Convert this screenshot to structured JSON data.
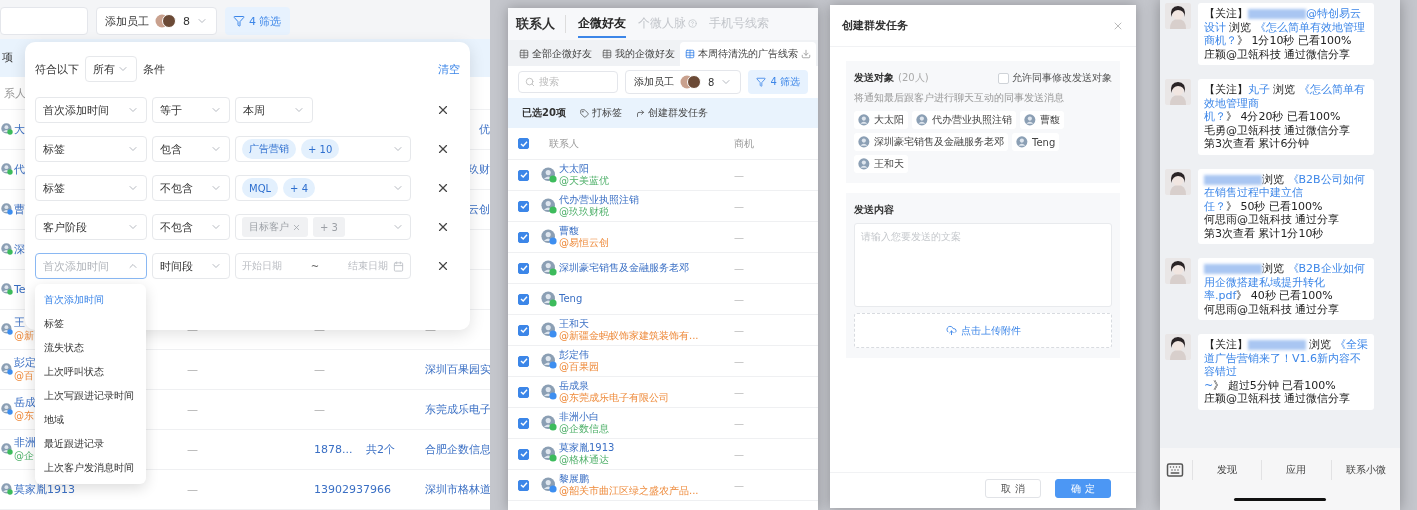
{
  "contacts_list": {
    "toolbar": {
      "staff_button": "添加员工",
      "staff_count": "8",
      "filter_button": "4 筛选"
    },
    "selection_bar_fragment": "项",
    "header_fragment": "系人",
    "rows": [
      {
        "name": "大",
        "kind": "wechat",
        "right": "优"
      },
      {
        "name": "代",
        "kind": "wechat",
        "right": "玖财"
      },
      {
        "name": "曹",
        "kind": "wecom",
        "right": "云创"
      },
      {
        "name": "深",
        "kind": "wechat"
      },
      {
        "name": "Te",
        "kind": "wechat"
      },
      {
        "name": "王",
        "sub": "@新",
        "kind": "wecom",
        "col_2": "—",
        "col_3": "—",
        "col_5": "—"
      },
      {
        "name": "彭定",
        "sub": "@百",
        "kind": "wecom",
        "col_2": "—",
        "col_3": "—",
        "col_5": "深圳百果园实"
      },
      {
        "name": "岳成",
        "sub": "@东",
        "kind": "wecom",
        "col_2": "—",
        "col_3": "—",
        "col_5": "东莞成乐电子"
      },
      {
        "name": "非洲",
        "sub": "@企",
        "kind": "wechat",
        "col_2": "—",
        "col_3": "1878...",
        "col_4": "共2个",
        "col_5": "合肥企数信息"
      },
      {
        "name": "莫家胤1913",
        "kind": "wechat",
        "col_2": "—",
        "col_3": "13902937966",
        "col_5": "深圳市格林道"
      }
    ],
    "filter_popover": {
      "match_prefix": "符合以下",
      "match_mode": "所有",
      "match_suffix": "条件",
      "clear": "清空",
      "conditions": [
        {
          "field": "首次添加时间",
          "operator": "等于",
          "value": {
            "kind": "select",
            "text": "本周"
          }
        },
        {
          "field": "标签",
          "operator": "包含",
          "value": {
            "kind": "tags",
            "tags": [
              "广告营销"
            ],
            "more": "+ 10"
          }
        },
        {
          "field": "标签",
          "operator": "不包含",
          "value": {
            "kind": "tags",
            "tags": [
              "MQL"
            ],
            "more": "+ 4"
          }
        },
        {
          "field": "客户阶段",
          "operator": "不包含",
          "value": {
            "kind": "removable",
            "tags": [
              "目标客户"
            ],
            "more": "+ 3"
          }
        },
        {
          "placeholder": "首次添加时间",
          "focused": true,
          "operator": "时间段",
          "value": {
            "kind": "daterange",
            "start": "开始日期",
            "separator": "~",
            "end": "结束日期"
          }
        }
      ],
      "dropdown": [
        {
          "label": "首次添加时间",
          "selected": true
        },
        {
          "label": "标签",
          "selected": false
        },
        {
          "label": "流失状态",
          "selected": false
        },
        {
          "label": "上次呼叫状态",
          "selected": false
        },
        {
          "label": "上次写跟进记录时间",
          "selected": false
        },
        {
          "label": "地域",
          "selected": false
        },
        {
          "label": "最近跟进记录",
          "selected": false
        },
        {
          "label": "上次客户发消息时间",
          "selected": false
        }
      ]
    }
  },
  "friends_view": {
    "title": "联系人",
    "tabs": [
      {
        "label": "企微好友",
        "selected": true
      },
      {
        "label": "个微人脉",
        "selected": false,
        "help": true
      },
      {
        "label": "手机号线索",
        "selected": false
      }
    ],
    "views": [
      {
        "label": "全部企微好友",
        "selected": false
      },
      {
        "label": "我的企微好友",
        "selected": false
      },
      {
        "label": "本周待清洗的广告线索",
        "selected": true
      }
    ],
    "search": {
      "placeholder": "搜索"
    },
    "staff_button": "添加员工",
    "staff_count": "8",
    "filter_button": "4 筛选",
    "selection_bar": {
      "count": "已选20项",
      "actions": [
        {
          "kind": "tag",
          "label": "打标签"
        },
        {
          "kind": "send",
          "label": "创建群发任务"
        }
      ]
    },
    "columns": [
      "联系人",
      "商机"
    ],
    "select_all": {
      "checked": true
    },
    "rows": [
      {
        "name": "大太阳",
        "sub": "@天美蓝优",
        "kind": "wechat",
        "checked": true,
        "deal": "—"
      },
      {
        "name": "代办营业执照注销",
        "sub": "@玖玖财税",
        "kind": "wechat",
        "checked": true,
        "deal": "—"
      },
      {
        "name": "曹馥",
        "sub": "@易恒云创",
        "kind": "wecom",
        "checked": true,
        "deal": "—"
      },
      {
        "name": "深圳豪宅销售及金融服务老邓",
        "kind": "wechat",
        "checked": true,
        "deal": "—"
      },
      {
        "name": "Teng",
        "kind": "wechat",
        "checked": true,
        "deal": "—"
      },
      {
        "name": "王和天",
        "sub": "@新疆金蚂蚁饰家建筑装饰有...",
        "kind": "wecom",
        "checked": true,
        "deal": "—"
      },
      {
        "name": "彭定伟",
        "sub": "@百果园",
        "kind": "wecom",
        "checked": true,
        "deal": "—"
      },
      {
        "name": "岳成泉",
        "sub": "@东莞成乐电子有限公司",
        "kind": "wecom",
        "checked": true,
        "deal": "—"
      },
      {
        "name": "非洲小白",
        "sub": "@企数信息",
        "kind": "wechat",
        "checked": true,
        "deal": "—"
      },
      {
        "name": "莫家胤1913",
        "sub": "@格林通达",
        "kind": "wechat",
        "checked": true,
        "deal": "—"
      },
      {
        "name": "黎展鹏",
        "sub": "@韶关市曲江区绿之盛农产品...",
        "kind": "wecom",
        "checked": true,
        "deal": "—"
      }
    ]
  },
  "broadcast_dialog": {
    "title": "创建群发任务",
    "recipients": {
      "label": "发送对象",
      "count": "(20人)",
      "allow_edit": {
        "label": "允许同事修改发送对象",
        "checked": false
      },
      "hint": "将通知最后跟客户进行聊天互动的同事发送消息",
      "chips": [
        "大太阳",
        "代办营业执照注销",
        "曹馥",
        "深圳豪宅销售及金融服务老邓",
        "Teng",
        "王和天"
      ]
    },
    "content": {
      "label": "发送内容",
      "placeholder": "请输入您要发送的文案",
      "upload": "点击上传附件"
    },
    "buttons": [
      {
        "kind": "secondary",
        "label": "取 消"
      },
      {
        "kind": "primary",
        "label": "确 定"
      }
    ]
  },
  "chat": {
    "messages": [
      {
        "segments": [
          {
            "kind": "text",
            "text": "【关注】"
          },
          {
            "kind": "blur"
          },
          {
            "kind": "link",
            "text": "@特创易云设计"
          },
          {
            "kind": "text",
            "text": " 浏览 "
          },
          {
            "kind": "link",
            "text": "《怎么简单有效地管理商机？"
          },
          {
            "kind": "text",
            "text": "》 1分10秒 已看100%"
          }
        ],
        "lines": [
          "庄颖@卫瓴科技 通过微信分享"
        ]
      },
      {
        "segments": [
          {
            "kind": "text",
            "text": "【关注】"
          },
          {
            "kind": "link",
            "text": "丸子"
          },
          {
            "kind": "text",
            "text": " 浏览 "
          },
          {
            "kind": "link",
            "text": "《怎么简单有效地管理商机？"
          },
          {
            "kind": "text",
            "text": "》 4分20秒 已看100%"
          }
        ],
        "lines": [
          "毛勇@卫瓴科技 通过微信分享",
          "第3次查看 累计6分钟"
        ]
      },
      {
        "segments": [
          {
            "kind": "blur"
          },
          {
            "kind": "text",
            "text": "浏览 "
          },
          {
            "kind": "link",
            "text": "《B2B公司如何在销售过程中建立信任？"
          },
          {
            "kind": "text",
            "text": "》 50秒 已看100%"
          }
        ],
        "lines": [
          "何思雨@卫瓴科技 通过分享",
          "第3次查看 累计1分10秒"
        ]
      },
      {
        "segments": [
          {
            "kind": "blur"
          },
          {
            "kind": "text",
            "text": "浏览 "
          },
          {
            "kind": "link",
            "text": "《B2B企业如何用企微搭建私域提升转化率.pdf"
          },
          {
            "kind": "text",
            "text": "》 40秒 已看100%"
          }
        ],
        "lines": [
          "何思雨@卫瓴科技 通过分享"
        ]
      },
      {
        "segments": [
          {
            "kind": "text",
            "text": "【关注】"
          },
          {
            "kind": "blur"
          },
          {
            "kind": "text",
            "text": " 浏览 "
          },
          {
            "kind": "link",
            "text": "《全渠道广告营销来了！V1.6新内容不容错过~"
          },
          {
            "kind": "text",
            "text": "》 超过5分钟 已看100%"
          }
        ],
        "lines": [
          "庄颖@卫瓴科技 通过微信分享"
        ]
      }
    ],
    "bottom_bar": [
      "发现",
      "应用",
      "联系小微"
    ]
  }
}
